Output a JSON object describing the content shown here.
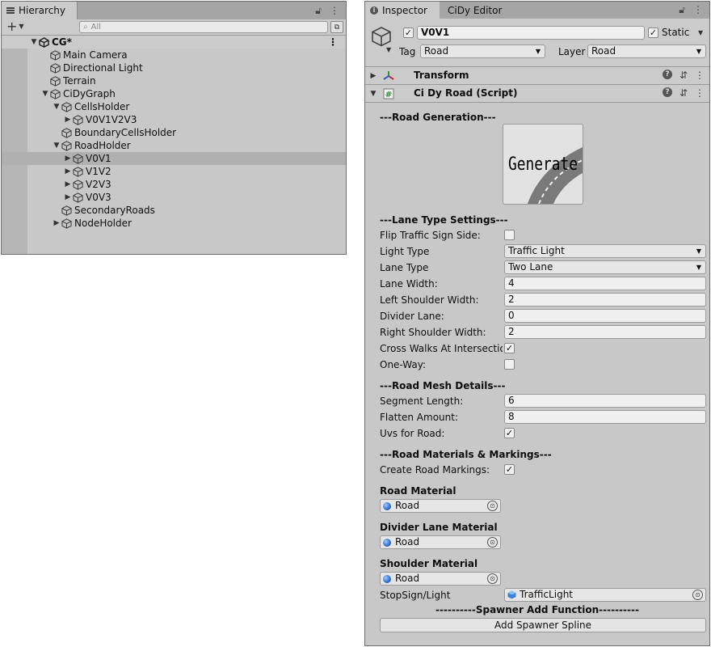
{
  "hierarchy": {
    "tab_label": "Hierarchy",
    "search_placeholder": "All",
    "scene": "CG*",
    "rows": [
      {
        "label": "Main Camera",
        "indent": 2,
        "arrow": "",
        "selected": false
      },
      {
        "label": "Directional Light",
        "indent": 2,
        "arrow": "",
        "selected": false
      },
      {
        "label": "Terrain",
        "indent": 2,
        "arrow": "",
        "selected": false
      },
      {
        "label": "CiDyGraph",
        "indent": 2,
        "arrow": "down",
        "selected": false
      },
      {
        "label": "CellsHolder",
        "indent": 3,
        "arrow": "down",
        "selected": false
      },
      {
        "label": "V0V1V2V3",
        "indent": 4,
        "arrow": "right",
        "selected": false
      },
      {
        "label": "BoundaryCellsHolder",
        "indent": 3,
        "arrow": "",
        "selected": false
      },
      {
        "label": "RoadHolder",
        "indent": 3,
        "arrow": "down",
        "selected": false
      },
      {
        "label": "V0V1",
        "indent": 4,
        "arrow": "right",
        "selected": true
      },
      {
        "label": "V1V2",
        "indent": 4,
        "arrow": "right",
        "selected": false
      },
      {
        "label": "V2V3",
        "indent": 4,
        "arrow": "right",
        "selected": false
      },
      {
        "label": "V0V3",
        "indent": 4,
        "arrow": "right",
        "selected": false
      },
      {
        "label": "SecondaryRoads",
        "indent": 3,
        "arrow": "",
        "selected": false
      },
      {
        "label": "NodeHolder",
        "indent": 3,
        "arrow": "right",
        "selected": false
      }
    ]
  },
  "inspector": {
    "tab_inspector": "Inspector",
    "tab_cidy": "CiDy Editor",
    "object_name": "V0V1",
    "static_label": "Static",
    "tag_label": "Tag",
    "tag_value": "Road",
    "layer_label": "Layer",
    "layer_value": "Road",
    "transform_title": "Transform",
    "script_title": "Ci Dy Road (Script)",
    "generate_label": "Generate",
    "sections": {
      "road_generation": "---Road Generation---",
      "lane_type_settings": "---Lane Type Settings---",
      "road_mesh_details": "---Road Mesh Details---",
      "materials_markings": "---Road Materials & Markings---",
      "spawner": "----------Spawner Add Function----------"
    },
    "props": {
      "flip_traffic_sign_side": "Flip Traffic Sign Side:",
      "light_type": "Light Type",
      "light_type_value": "Traffic Light",
      "lane_type": "Lane Type",
      "lane_type_value": "Two Lane",
      "lane_width": "Lane Width:",
      "lane_width_value": "4",
      "left_shoulder_width": "Left Shoulder Width:",
      "left_shoulder_width_value": "2",
      "divider_lane": "Divider Lane:",
      "divider_lane_value": "0",
      "right_shoulder_width": "Right Shoulder Width:",
      "right_shoulder_width_value": "2",
      "cross_walks": "Cross Walks At Intersections",
      "one_way": "One-Way:",
      "segment_length": "Segment Length:",
      "segment_length_value": "6",
      "flatten_amount": "Flatten Amount:",
      "flatten_amount_value": "8",
      "uvs_for_road": "Uvs for Road:",
      "create_road_markings": "Create Road Markings:",
      "road_material": "Road Material",
      "road_material_value": "Road",
      "divider_lane_material": "Divider Lane Material",
      "divider_lane_material_value": "Road",
      "shoulder_material": "Shoulder Material",
      "shoulder_material_value": "Road",
      "stopsign_light": "StopSign/Light",
      "stopsign_light_value": "TrafficLight"
    },
    "spawner_button": "Add Spawner Spline",
    "check_mark": "✓"
  }
}
